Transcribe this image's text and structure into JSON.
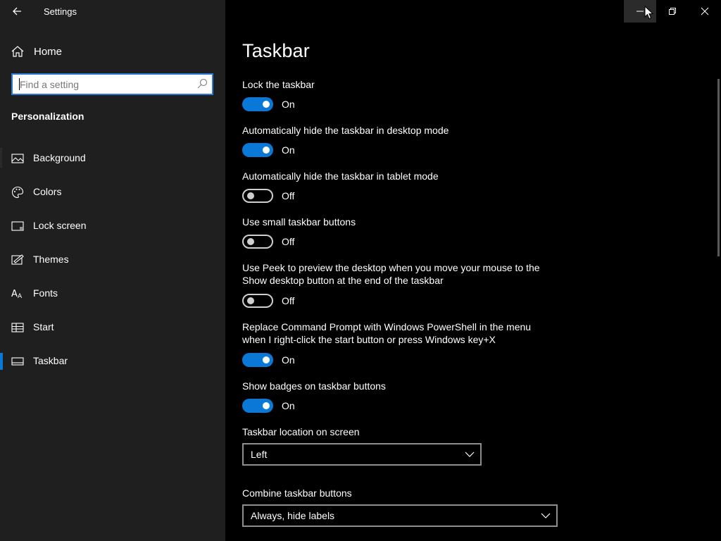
{
  "window": {
    "app_title": "Settings"
  },
  "sidebar": {
    "home_label": "Home",
    "search_placeholder": "Find a setting",
    "section_label": "Personalization",
    "items": [
      {
        "label": "Background",
        "icon": "image-icon"
      },
      {
        "label": "Colors",
        "icon": "palette-icon"
      },
      {
        "label": "Lock screen",
        "icon": "lock-screen-icon"
      },
      {
        "label": "Themes",
        "icon": "themes-icon"
      },
      {
        "label": "Fonts",
        "icon": "fonts-icon"
      },
      {
        "label": "Start",
        "icon": "start-icon"
      },
      {
        "label": "Taskbar",
        "icon": "taskbar-icon",
        "selected": true
      }
    ]
  },
  "main": {
    "title": "Taskbar",
    "settings": [
      {
        "title": "Lock the taskbar",
        "state": "On"
      },
      {
        "title": "Automatically hide the taskbar in desktop mode",
        "state": "On"
      },
      {
        "title": "Automatically hide the taskbar in tablet mode",
        "state": "Off"
      },
      {
        "title": "Use small taskbar buttons",
        "state": "Off"
      },
      {
        "title_line1": "Use Peek to preview the desktop when you move your mouse to the",
        "title_line2": "Show desktop button at the end of the taskbar",
        "state": "Off"
      },
      {
        "title_line1": "Replace Command Prompt with Windows PowerShell in the menu",
        "title_line2": "when I right-click the start button or press Windows key+X",
        "state": "On"
      },
      {
        "title": "Show badges on taskbar buttons",
        "state": "On"
      }
    ],
    "location": {
      "label": "Taskbar location on screen",
      "value": "Left"
    },
    "combine": {
      "label": "Combine taskbar buttons",
      "value": "Always, hide labels"
    }
  },
  "colors": {
    "accent": "#0a78d7",
    "sidebar_bg": "#1f1f1f",
    "main_bg": "#000000"
  }
}
